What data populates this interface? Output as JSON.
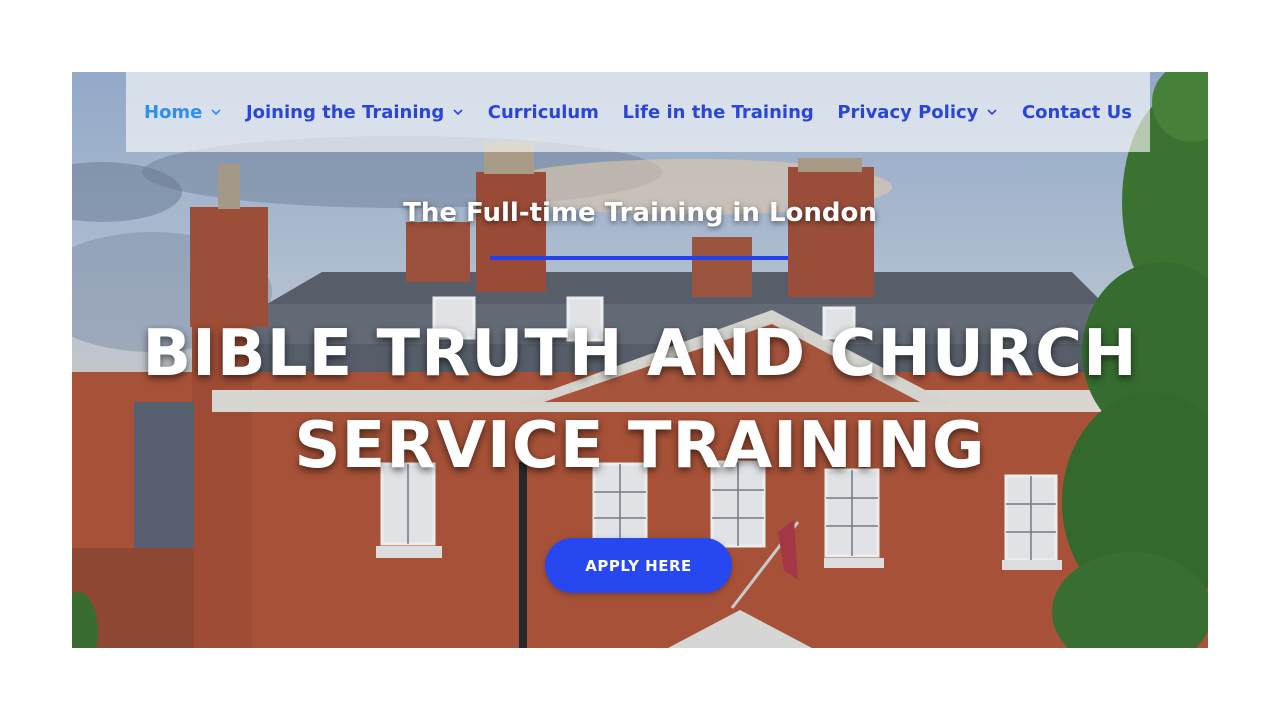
{
  "nav": {
    "items": [
      {
        "label": "Home",
        "has_dropdown": true,
        "active": true
      },
      {
        "label": "Joining the Training",
        "has_dropdown": true,
        "active": false
      },
      {
        "label": "Curriculum",
        "has_dropdown": false,
        "active": false
      },
      {
        "label": "Life in the Training",
        "has_dropdown": false,
        "active": false
      },
      {
        "label": "Privacy Policy",
        "has_dropdown": true,
        "active": false
      },
      {
        "label": "Contact Us",
        "has_dropdown": false,
        "active": false
      }
    ]
  },
  "hero": {
    "subtitle": "The Full-time Training in London",
    "headline_line1": "BIBLE TRUTH AND CHURCH",
    "headline_line2": "SERVICE TRAINING",
    "cta_label": "APPLY HERE"
  },
  "colors": {
    "nav_text": "#2a46d8",
    "nav_active": "#2f8ff0",
    "accent": "#2747f0",
    "brick": "#b5573a"
  }
}
